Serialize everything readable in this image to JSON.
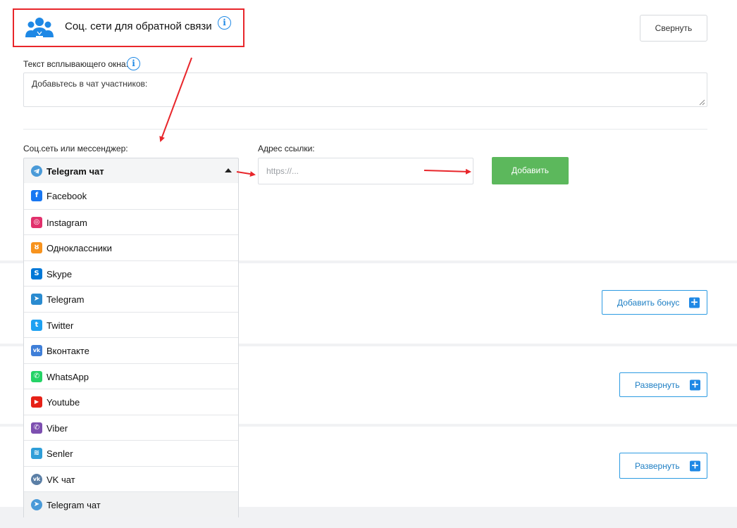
{
  "section": {
    "title": "Соц. сети для обратной связи",
    "collapse_label": "Свернуть"
  },
  "popup": {
    "label": "Текст всплывающего окна:",
    "value": "Добавьтесь в чат участников:"
  },
  "form": {
    "social_label": "Соц.сеть или мессенджер:",
    "selected": "Telegram чат",
    "url_label": "Адрес ссылки:",
    "url_placeholder": "https://...",
    "add_label": "Добавить"
  },
  "options": [
    {
      "label": "Facebook",
      "icon": "facebook-icon",
      "color": "#1877f2"
    },
    {
      "label": "Instagram",
      "icon": "instagram-icon",
      "color": "#e1306c"
    },
    {
      "label": "Одноклассники",
      "icon": "odnoklassniki-icon",
      "color": "#f7931e"
    },
    {
      "label": "Skype",
      "icon": "skype-icon",
      "color": "#0078d7"
    },
    {
      "label": "Telegram",
      "icon": "telegram-icon",
      "color": "#2a8bd0"
    },
    {
      "label": "Twitter",
      "icon": "twitter-icon",
      "color": "#1da1f2"
    },
    {
      "label": "Вконтакте",
      "icon": "vk-icon",
      "color": "#3f7fd8"
    },
    {
      "label": "WhatsApp",
      "icon": "whatsapp-icon",
      "color": "#25d366"
    },
    {
      "label": "Youtube",
      "icon": "youtube-icon",
      "color": "#e62117"
    },
    {
      "label": "Viber",
      "icon": "viber-icon",
      "color": "#7d4fb0"
    },
    {
      "label": "Senler",
      "icon": "senler-icon",
      "color": "#2f9ed8"
    },
    {
      "label": "VK чат",
      "icon": "vk-chat-icon",
      "color": "#5b7fa6"
    },
    {
      "label": "Telegram чат",
      "icon": "telegram-chat-icon",
      "color": "#4a9ad8"
    }
  ],
  "buttons": {
    "add_bonus": "Добавить бонус",
    "expand": "Развернуть"
  },
  "colors": {
    "accent_green": "#5cb85c",
    "accent_blue": "#1e88e5",
    "annotation_red": "#e8262b"
  }
}
